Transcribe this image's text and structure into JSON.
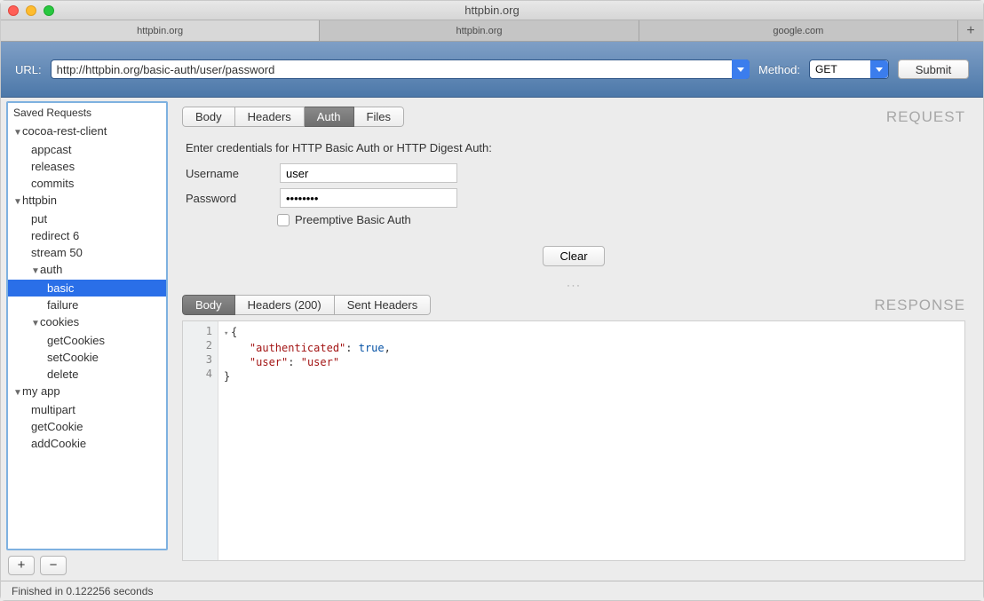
{
  "window": {
    "title": "httpbin.org"
  },
  "tabs": {
    "items": [
      {
        "label": "httpbin.org",
        "active": true
      },
      {
        "label": "httpbin.org",
        "active": false
      },
      {
        "label": "google.com",
        "active": false
      }
    ]
  },
  "urlbar": {
    "label": "URL:",
    "value": "http://httpbin.org/basic-auth/user/password",
    "method_label": "Method:",
    "method_value": "GET",
    "submit_label": "Submit"
  },
  "sidebar": {
    "title": "Saved Requests",
    "tree": [
      {
        "label": "cocoa-rest-client",
        "depth": 0,
        "disclosure": "down"
      },
      {
        "label": "appcast",
        "depth": 1
      },
      {
        "label": "releases",
        "depth": 1
      },
      {
        "label": "commits",
        "depth": 1
      },
      {
        "label": "httpbin",
        "depth": 0,
        "disclosure": "down"
      },
      {
        "label": "put",
        "depth": 1
      },
      {
        "label": "redirect 6",
        "depth": 1
      },
      {
        "label": "stream 50",
        "depth": 1
      },
      {
        "label": "auth",
        "depth": 1,
        "disclosure": "down"
      },
      {
        "label": "basic",
        "depth": 2,
        "selected": true
      },
      {
        "label": "failure",
        "depth": 2
      },
      {
        "label": "cookies",
        "depth": 1,
        "disclosure": "down"
      },
      {
        "label": "getCookies",
        "depth": 2
      },
      {
        "label": "setCookie",
        "depth": 2
      },
      {
        "label": "delete",
        "depth": 2
      },
      {
        "label": "my app",
        "depth": 0,
        "disclosure": "down"
      },
      {
        "label": "multipart",
        "depth": 1
      },
      {
        "label": "getCookie",
        "depth": 1
      },
      {
        "label": "addCookie",
        "depth": 1
      }
    ],
    "add_label": "+",
    "remove_label": "−"
  },
  "request": {
    "section_title": "REQUEST",
    "tabs": [
      "Body",
      "Headers",
      "Auth",
      "Files"
    ],
    "active_tab": "Auth",
    "auth": {
      "description": "Enter credentials for HTTP Basic Auth or HTTP Digest Auth:",
      "username_label": "Username",
      "username_value": "user",
      "password_label": "Password",
      "password_value": "••••••••",
      "preemptive_label": "Preemptive Basic Auth",
      "preemptive_checked": false,
      "clear_label": "Clear"
    }
  },
  "response": {
    "section_title": "RESPONSE",
    "tabs": [
      "Body",
      "Headers (200)",
      "Sent Headers"
    ],
    "active_tab": "Body",
    "lines": [
      "1",
      "2",
      "3",
      "4"
    ],
    "json": {
      "open": "{",
      "l2_key": "\"authenticated\"",
      "l2_val": "true",
      "l3_key": "\"user\"",
      "l3_val": "\"user\"",
      "close": "}"
    }
  },
  "status": {
    "text": "Finished in 0.122256 seconds"
  }
}
